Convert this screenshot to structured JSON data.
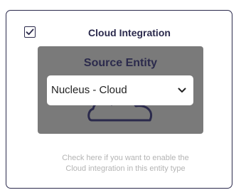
{
  "card": {
    "checkbox_checked": true,
    "title": "Cloud Integration",
    "help_line_1": "Check here if you want to enable the",
    "help_line_2": "Cloud integration in this entity type"
  },
  "preview": {
    "heading": "Source Entity",
    "select_value": "Nucleus - Cloud",
    "background_icon": "cloud-icon"
  },
  "colors": {
    "accent": "#2b2a4c",
    "panel_bg": "#7a7a7a",
    "help_text": "#b4b4b4"
  }
}
